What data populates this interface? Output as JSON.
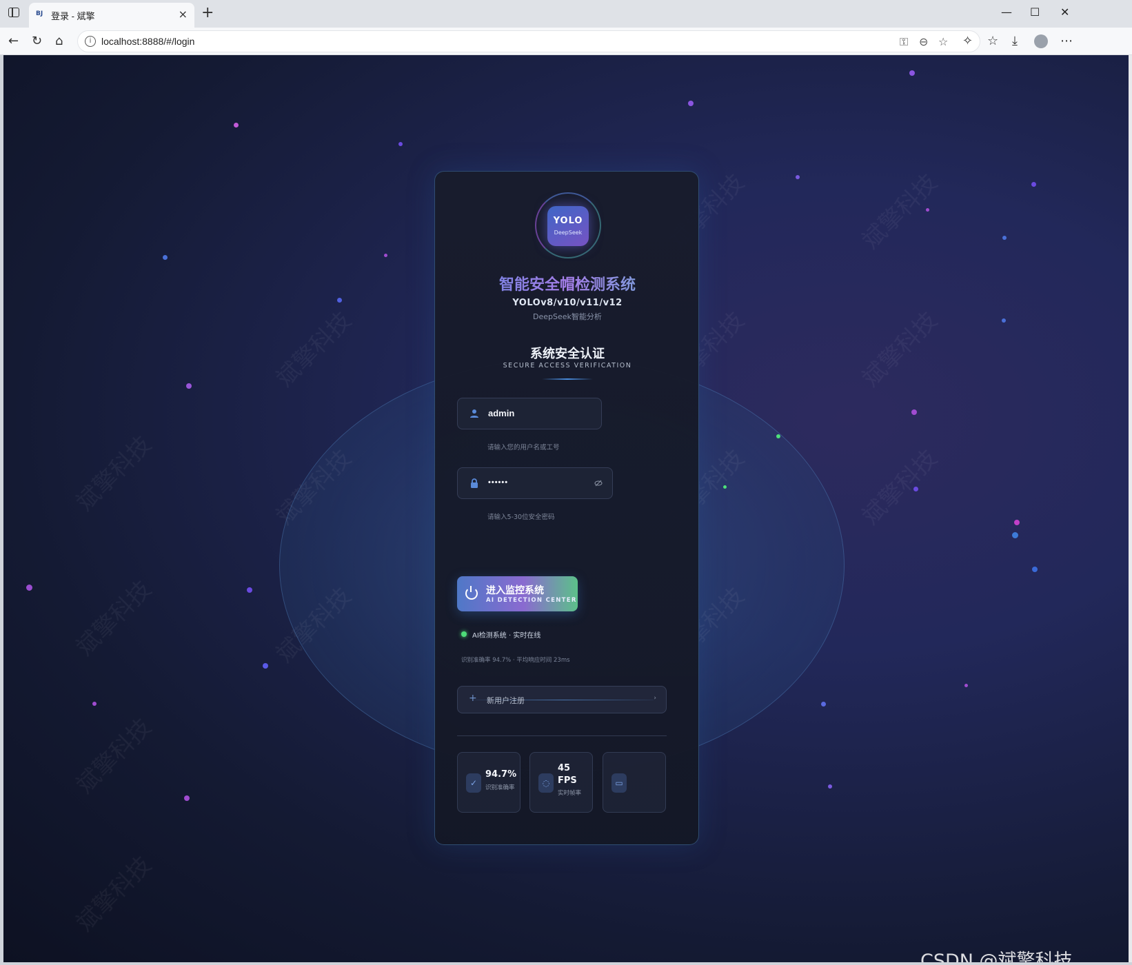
{
  "browser": {
    "tab_favicon": "BJ",
    "tab_title": "登录 - 斌擎",
    "tab_close": "×",
    "new_tab": "+",
    "url": "localhost:8888/#/login",
    "info_icon": "i",
    "window_controls": [
      "—",
      "☐",
      "✕"
    ]
  },
  "card": {
    "logo_top": "YOLO",
    "logo_bottom": "DeepSeek",
    "title": "智能安全帽检测系统",
    "subtitle": "YOLOv8/v10/v11/v12",
    "subtitle2": "DeepSeek智能分析",
    "auth_title": "系统安全认证",
    "auth_subtitle": "SECURE ACCESS VERIFICATION",
    "username": {
      "value": "admin",
      "hint": "请输入您的用户名或工号"
    },
    "password": {
      "value": "••••••",
      "hint": "请输入5-30位安全密码"
    },
    "enter_button": {
      "title": "进入监控系统",
      "subtitle": "AI DETECTION CENTER"
    },
    "status": "AI检测系统 · 实时在线",
    "stats_line": "识别准确率 94.7% · 平均响应时间 23ms",
    "register": {
      "plus": "+",
      "label": "新用户注册",
      "arrow": "›"
    },
    "metrics": [
      {
        "icon": "check-icon",
        "value": "94.7%",
        "label": "识别准确率"
      },
      {
        "icon": "refresh-icon",
        "value": "45 FPS",
        "label": "实时帧率"
      },
      {
        "icon": "camera-icon",
        "value": "",
        "label": ""
      }
    ]
  },
  "watermark_text": "斌擎科技",
  "csdn_credit": "CSDN @斌擎科技"
}
